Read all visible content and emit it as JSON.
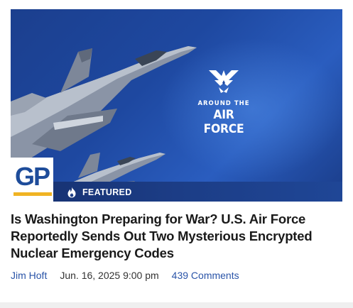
{
  "hero": {
    "overlay_line1": "AROUND THE",
    "overlay_line2": "AIR FORCE",
    "site_logo_text": "GP",
    "badge_label": "FEATURED",
    "emblem_icon": "air-force-wing-icon",
    "badge_icon": "flame-icon"
  },
  "article": {
    "title": "Is Washington Preparing for War? U.S. Air Force Reportedly Sends Out Two Mysterious Encrypted Nuclear Emergency Codes",
    "author": "Jim Hoft",
    "date": "Jun. 16, 2025 9:00 pm",
    "comments": "439 Comments"
  },
  "colors": {
    "accent": "#2a54a8",
    "hero_blue": "#1e48a0",
    "logo_gold": "#f0b323",
    "title_text": "#1a1a1a"
  }
}
